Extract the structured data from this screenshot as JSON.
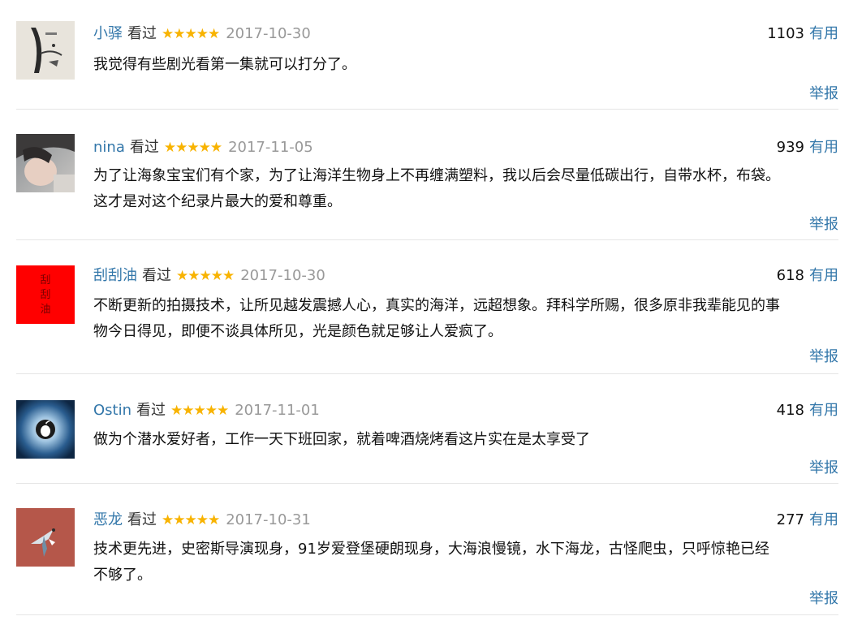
{
  "comments": [
    {
      "user": "小驿",
      "status": "看过",
      "stars": "★★★★★",
      "date": "2017-10-30",
      "votes": "1103",
      "useful_label": "有用",
      "text": "我觉得有些剧光看第一集就可以打分了。",
      "report_label": "举报"
    },
    {
      "user": "nina",
      "status": "看过",
      "stars": "★★★★★",
      "date": "2017-11-05",
      "votes": "939",
      "useful_label": "有用",
      "text": "为了让海象宝宝们有个家，为了让海洋生物身上不再缠满塑料，我以后会尽量低碳出行，自带水杯，布袋。\n这才是对这个纪录片最大的爱和尊重。",
      "report_label": "举报"
    },
    {
      "user": "刮刮油",
      "status": "看过",
      "stars": "★★★★★",
      "date": "2017-10-30",
      "votes": "618",
      "useful_label": "有用",
      "text": "不断更新的拍摄技术，让所见越发震撼人心，真实的海洋，远超想象。拜科学所赐，很多原非我辈能见的事\n物今日得见，即便不谈具体所见，光是颜色就足够让人爱疯了。",
      "report_label": "举报",
      "avatar_text": "刮刮油"
    },
    {
      "user": "Ostin",
      "status": "看过",
      "stars": "★★★★★",
      "date": "2017-11-01",
      "votes": "418",
      "useful_label": "有用",
      "text": "做为个潜水爱好者，工作一天下班回家，就着啤酒烧烤看这片实在是太享受了",
      "report_label": "举报"
    },
    {
      "user": "恶龙",
      "status": "看过",
      "stars": "★★★★★",
      "date": "2017-10-31",
      "votes": "277",
      "useful_label": "有用",
      "text": "技术更先进，史密斯导演现身，91岁爱登堡硬朗现身，大海浪慢镜，水下海龙，古怪爬虫，只呼惊艳已经\n不够了。",
      "report_label": "举报"
    }
  ],
  "colors": {
    "link": "#3377aa",
    "star": "#f8b300",
    "date": "#999999",
    "divider": "#e5e5e5"
  }
}
